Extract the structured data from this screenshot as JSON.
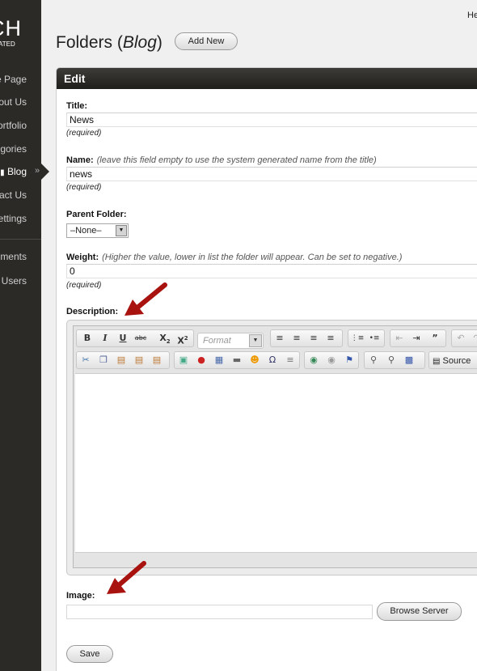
{
  "sidebar": {
    "logo_text": "CH",
    "logo_subtext": "ICATED",
    "items": [
      {
        "label": "e Page"
      },
      {
        "label": "out Us"
      },
      {
        "label": "ortfolio"
      },
      {
        "label": "gories"
      },
      {
        "label": "Blog"
      },
      {
        "label": "act Us"
      },
      {
        "label": "ettings"
      },
      {
        "label": "ments"
      },
      {
        "label": "Users"
      }
    ]
  },
  "header": {
    "greeting": "He",
    "title_prefix": "Folders (",
    "title_em": "Blog",
    "title_suffix": ")",
    "add_new_label": "Add New"
  },
  "panel": {
    "title": "Edit"
  },
  "form": {
    "title_label": "Title:",
    "title_value": "News",
    "required": "(required)",
    "name_label": "Name:",
    "name_hint": "(leave this field empty to use the system generated name from the title)",
    "name_value": "news",
    "parent_label": "Parent Folder:",
    "parent_value": "–None–",
    "weight_label": "Weight:",
    "weight_hint": "(Higher the value, lower in list the folder will appear. Can be set to negative.)",
    "weight_value": "0",
    "description_label": "Description:",
    "format_placeholder": "Format",
    "source_label": "Source",
    "image_label": "Image:",
    "browse_label": "Browse Server",
    "save_label": "Save"
  },
  "colors": {
    "sidebar_bg": "#2b2a27",
    "arrow_red": "#a8120f"
  }
}
